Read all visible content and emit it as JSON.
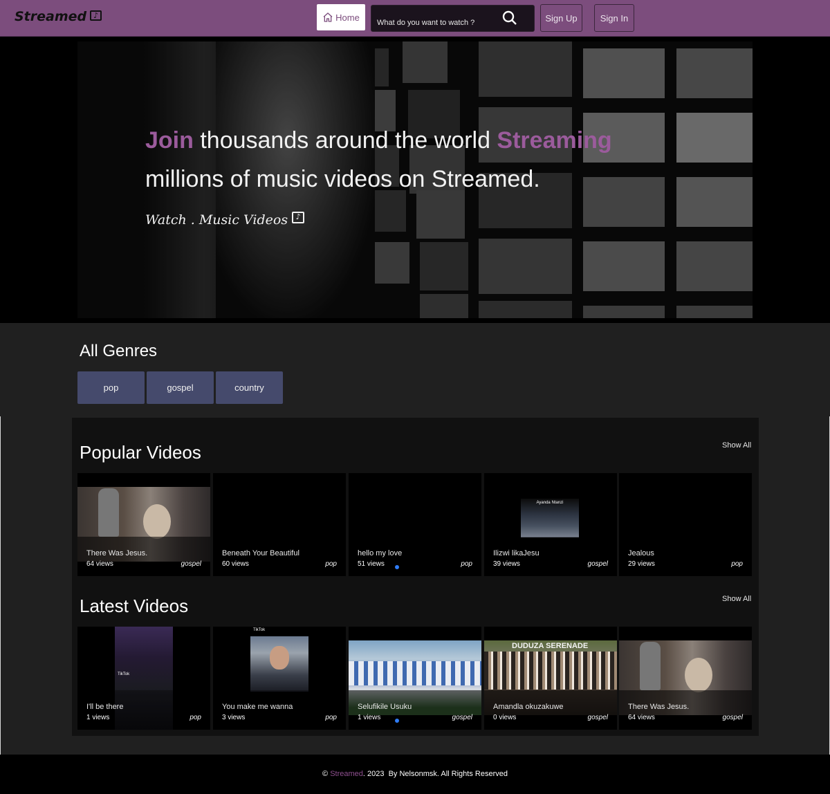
{
  "nav": {
    "brand": "Streamed",
    "brand_icon": "music-note-box-icon",
    "home_label": "Home",
    "search_placeholder": "What do you want to watch ?",
    "signup_label": "Sign Up",
    "signin_label": "Sign In"
  },
  "hero": {
    "line1_accent1": "Join",
    "line1_mid": " thousands around the world ",
    "line1_accent2": "Streaming",
    "line2": "millions of music videos on Streamed.",
    "tagline": "Watch . Music Videos"
  },
  "genres": {
    "title": "All Genres",
    "items": [
      "pop",
      "gospel",
      "country"
    ]
  },
  "popular": {
    "title": "Popular Videos",
    "show_all": "Show All",
    "videos": [
      {
        "title": "There Was Jesus.",
        "views": "64 views",
        "genre": "gospel"
      },
      {
        "title": "Beneath Your Beautiful",
        "views": "60 views",
        "genre": "pop"
      },
      {
        "title": "hello my love",
        "views": "51 views",
        "genre": "pop"
      },
      {
        "title": "Ilizwi likaJesu",
        "views": "39 views",
        "genre": "gospel"
      },
      {
        "title": "Jealous",
        "views": "29 views",
        "genre": "pop"
      }
    ]
  },
  "latest": {
    "title": "Latest Videos",
    "show_all": "Show All",
    "videos": [
      {
        "title": "I'll be there",
        "views": "1 views",
        "genre": "pop"
      },
      {
        "title": "You make me wanna",
        "views": "3 views",
        "genre": "pop"
      },
      {
        "title": "Selufikile Usuku",
        "views": "1 views",
        "genre": "gospel"
      },
      {
        "title": "Amandla okuzakuwe",
        "views": "0 views",
        "genre": "gospel"
      },
      {
        "title": "There Was Jesus.",
        "views": "64 views",
        "genre": "gospel"
      }
    ]
  },
  "thumb_text": {
    "ilizwi_overlay": "Ayanda Ntanzi",
    "duduza": "DUDUZA SERENADE",
    "tiktok": "TikTok"
  },
  "footer": {
    "copyright": "©",
    "brand": "Streamed",
    "rest": ". 2023  By Nelsonmsk. All Rights Reserved"
  },
  "colors": {
    "nav_bg": "#7c4d7d",
    "accent": "#9b5b9c",
    "genre_bg": "#454a6c",
    "page_bg": "#202020",
    "panel_bg": "#111111",
    "dot": "#2f7cf6"
  }
}
